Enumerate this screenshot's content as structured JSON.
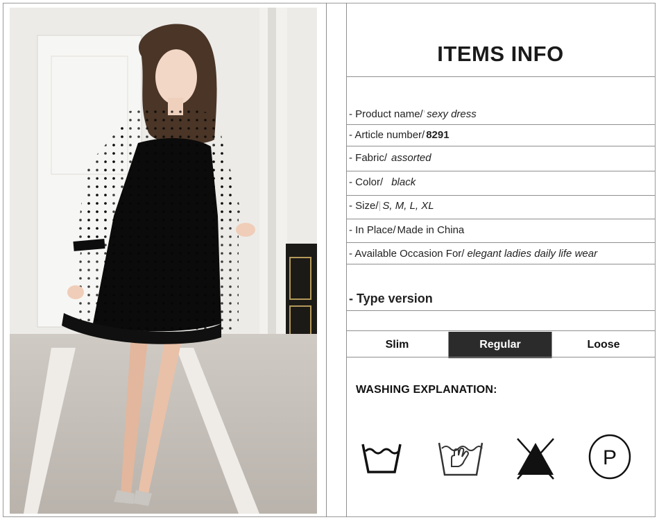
{
  "header": {
    "title": "ITEMS INFO"
  },
  "specs": [
    {
      "label": "- Product name/",
      "sep": "’",
      "value": "sexy dress",
      "style": "italic"
    },
    {
      "label": "- Article number/",
      "sep": "",
      "value": "8291",
      "style": "bold"
    },
    {
      "label": "- Fabric/",
      "sep": "",
      "value": "assorted",
      "style": "italic"
    },
    {
      "label": "- Color/",
      "sep": "",
      "value": "black",
      "style": "italic"
    },
    {
      "label": "- Size/",
      "sep": "|",
      "value": "S, M, L, XL",
      "style": "italic"
    },
    {
      "label": "- In Place/",
      "sep": "",
      "value": "Made in China",
      "style": "plain"
    },
    {
      "label": "- Available Occasion For/",
      "sep": "",
      "value": "elegant ladies daily life wear",
      "style": "italic"
    }
  ],
  "type_version": {
    "heading": "- Type version",
    "options": [
      "Slim",
      "Regular",
      "Loose"
    ],
    "selected": "Regular"
  },
  "washing": {
    "heading": "WASHING EXPLANATION:",
    "icons": [
      "wash-tub-icon",
      "hand-wash-icon",
      "no-bleach-icon",
      "dry-clean-p-icon"
    ],
    "p_letter": "P"
  },
  "colors": {
    "selected_bg": "#2b2b2b",
    "border": "#8e8e8e"
  }
}
